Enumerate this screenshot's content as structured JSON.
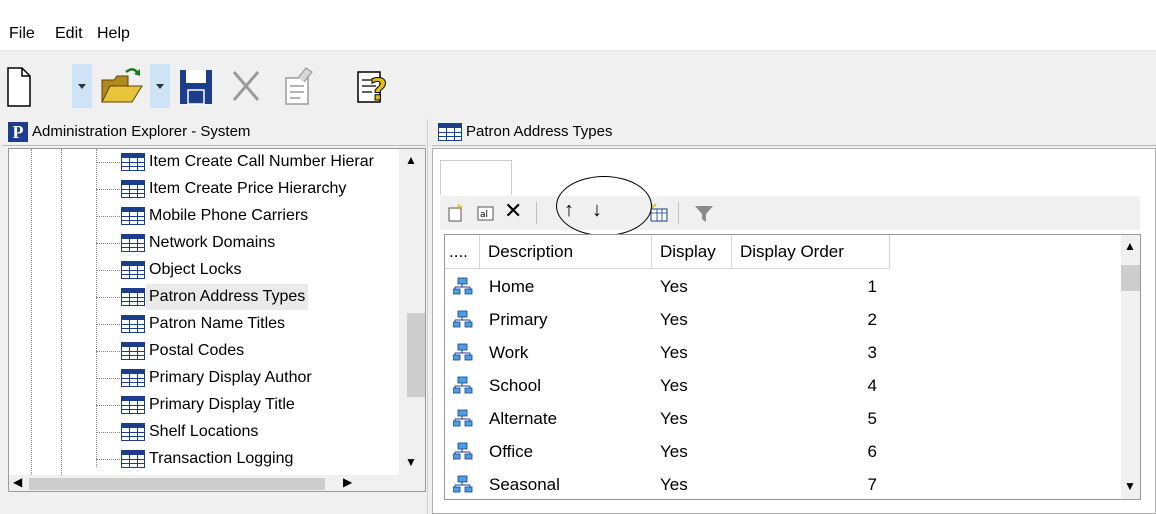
{
  "menu": {
    "file": "File",
    "edit": "Edit",
    "help": "Help"
  },
  "toolbar": {
    "icons": [
      "new-document-icon",
      "open-folder-icon",
      "save-icon",
      "delete-icon",
      "properties-icon",
      "help-icon"
    ]
  },
  "explorer": {
    "title": "Administration Explorer - System",
    "items": [
      {
        "label": "Item Create Call Number Hierar"
      },
      {
        "label": "Item Create Price Hierarchy"
      },
      {
        "label": "Mobile Phone Carriers"
      },
      {
        "label": "Network Domains"
      },
      {
        "label": "Object Locks"
      },
      {
        "label": "Patron Address Types",
        "selected": true
      },
      {
        "label": "Patron Name Titles"
      },
      {
        "label": "Postal Codes"
      },
      {
        "label": "Primary Display Author"
      },
      {
        "label": "Primary Display Title"
      },
      {
        "label": "Shelf Locations"
      },
      {
        "label": "Transaction Logging"
      }
    ]
  },
  "detail": {
    "title": "Patron Address Types",
    "grid_toolbar_icons": [
      "new-row-icon",
      "edit-text-icon",
      "delete-x-icon",
      "move-up-icon",
      "move-down-icon",
      "new-table-icon",
      "filter-icon"
    ],
    "columns": [
      "....",
      "Description",
      "Display",
      "Display Order"
    ],
    "rows": [
      {
        "description": "Home",
        "display": "Yes",
        "order": "1"
      },
      {
        "description": "Primary",
        "display": "Yes",
        "order": "2"
      },
      {
        "description": "Work",
        "display": "Yes",
        "order": "3"
      },
      {
        "description": "School",
        "display": "Yes",
        "order": "4"
      },
      {
        "description": "Alternate",
        "display": "Yes",
        "order": "5"
      },
      {
        "description": "Office",
        "display": "Yes",
        "order": "6"
      },
      {
        "description": "Seasonal",
        "display": "Yes",
        "order": "7"
      }
    ]
  },
  "colors": {
    "icon_blue": "#1c3d8c",
    "folder_yellow": "#e8c33c",
    "selected_bg": "#eaeaea"
  }
}
